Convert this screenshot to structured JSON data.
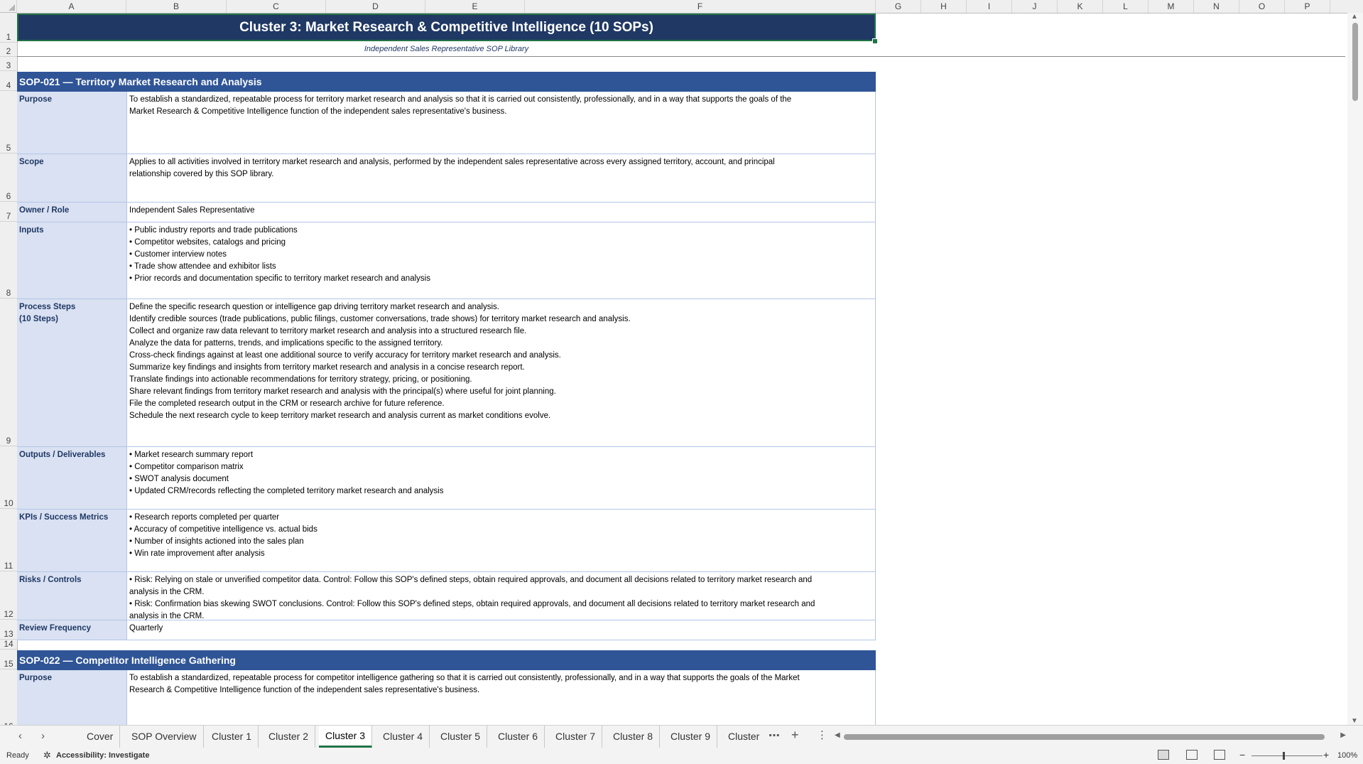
{
  "columns": [
    "A",
    "B",
    "C",
    "D",
    "E",
    "F",
    "G",
    "H",
    "I",
    "J",
    "K",
    "L",
    "M",
    "N",
    "O",
    "P"
  ],
  "rows": [
    "1",
    "2",
    "3",
    "4",
    "5",
    "6",
    "7",
    "8",
    "9",
    "10",
    "11",
    "12",
    "13",
    "14",
    "15",
    "16"
  ],
  "title": "Cluster 3: Market Research & Competitive Intelligence  (10 SOPs)",
  "subtitle": "Independent Sales Representative SOP Library",
  "sop1": {
    "header": "SOP-021  —  Territory Market Research and Analysis",
    "purpose_label": "Purpose",
    "purpose": [
      "To establish a standardized, repeatable process for territory market research and analysis so that it is carried out consistently, professionally, and in a way that supports the goals of the",
      "Market Research & Competitive Intelligence function of the independent sales representative's business."
    ],
    "scope_label": "Scope",
    "scope": [
      "Applies to all activities involved in territory market research and analysis, performed by the independent sales representative across every assigned territory, account, and principal",
      "relationship covered by this SOP library."
    ],
    "owner_label": "Owner / Role",
    "owner": "Independent Sales Representative",
    "inputs_label": "Inputs",
    "inputs": [
      "• Public industry reports and trade publications",
      "• Competitor websites, catalogs and pricing",
      "• Customer interview notes",
      "• Trade show attendee and exhibitor lists",
      "• Prior records and documentation specific to territory market research and analysis"
    ],
    "steps_label_1": "Process Steps",
    "steps_label_2": "(10 Steps)",
    "steps": [
      "Define the specific research question or intelligence gap driving territory market research and analysis.",
      "Identify credible sources (trade publications, public filings, customer conversations, trade shows) for territory market research and analysis.",
      "Collect and organize raw data relevant to territory market research and analysis into a structured research file.",
      "Analyze the data for patterns, trends, and implications specific to the assigned territory.",
      "Cross-check findings against at least one additional source to verify accuracy for territory market research and analysis.",
      "Summarize key findings and insights from territory market research and analysis in a concise research report.",
      "Translate findings into actionable recommendations for territory strategy, pricing, or positioning.",
      "Share relevant findings from territory market research and analysis with the principal(s) where useful for joint planning.",
      "File the completed research output in the CRM or research archive for future reference.",
      "Schedule the next research cycle to keep territory market research and analysis current as market conditions evolve."
    ],
    "outputs_label": "Outputs / Deliverables",
    "outputs": [
      "• Market research summary report",
      "• Competitor comparison matrix",
      "• SWOT analysis document",
      "• Updated CRM/records reflecting the completed territory market research and analysis"
    ],
    "kpis_label": "KPIs / Success Metrics",
    "kpis": [
      "• Research reports completed per quarter",
      "• Accuracy of competitive intelligence vs. actual bids",
      "• Number of insights actioned into the sales plan",
      "• Win rate improvement after analysis"
    ],
    "risks_label": "Risks / Controls",
    "risks": [
      "• Risk: Relying on stale or unverified competitor data. Control: Follow this SOP's defined steps, obtain required approvals, and document all decisions related to territory market research and",
      "analysis in the CRM.",
      "• Risk: Confirmation bias skewing SWOT conclusions. Control: Follow this SOP's defined steps, obtain required approvals, and document all decisions related to territory market research and",
      "analysis in the CRM."
    ],
    "review_label": "Review Frequency",
    "review": "Quarterly"
  },
  "sop2": {
    "header": "SOP-022  —  Competitor Intelligence Gathering",
    "purpose_label": "Purpose",
    "purpose": [
      "To establish a standardized, repeatable process for competitor intelligence gathering so that it is carried out consistently, professionally, and in a way that supports the goals of the Market",
      "Research & Competitive Intelligence function of the independent sales representative's business."
    ]
  },
  "tabs": [
    "Cover",
    "SOP Overview",
    "Cluster 1",
    "Cluster 2",
    "Cluster 3",
    "Cluster 4",
    "Cluster 5",
    "Cluster 6",
    "Cluster 7",
    "Cluster 8",
    "Cluster 9",
    "Cluster"
  ],
  "active_tab": "Cluster 3",
  "status": {
    "ready": "Ready",
    "accessibility": "Accessibility: Investigate",
    "zoom": "100%"
  }
}
